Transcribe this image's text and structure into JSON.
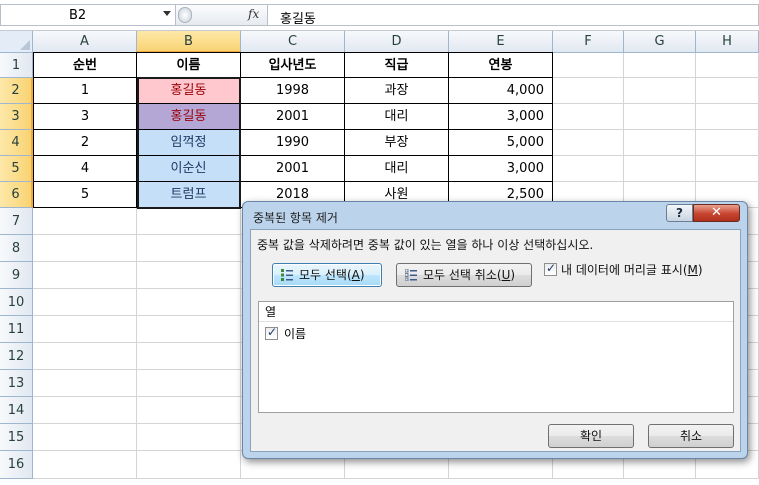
{
  "formula_bar": {
    "name_box": "B2",
    "fx_label": "fx",
    "content": "홍길동"
  },
  "columns": [
    "A",
    "B",
    "C",
    "D",
    "E",
    "F",
    "G",
    "H"
  ],
  "rows": [
    "1",
    "2",
    "3",
    "4",
    "5",
    "6",
    "7",
    "8",
    "9",
    "10",
    "11",
    "12",
    "13",
    "14",
    "15",
    "16"
  ],
  "table": {
    "headers": [
      "순번",
      "이름",
      "입사년도",
      "직급",
      "연봉"
    ],
    "data": [
      [
        "1",
        "홍길동",
        "1998",
        "과장",
        "4,000"
      ],
      [
        "3",
        "홍길동",
        "2001",
        "대리",
        "3,000"
      ],
      [
        "2",
        "임꺽정",
        "1990",
        "부장",
        "5,000"
      ],
      [
        "4",
        "이순신",
        "2001",
        "대리",
        "3,000"
      ],
      [
        "5",
        "트럼프",
        "2018",
        "사원",
        "2,500"
      ]
    ],
    "name_fill_colors": [
      "#ffc7ce",
      "#b4a7d6",
      "#c5dff8",
      "#c5dff8",
      "#c5dff8"
    ],
    "name_text_colors": [
      "#9c0006",
      "#9c0006",
      "#1f3864",
      "#1f3864",
      "#1f3864"
    ]
  },
  "dialog": {
    "title": "중복된 항목 제거",
    "help_label": "?",
    "close_label": "✕",
    "message": "중복 값을 삭제하려면 중복 값이 있는 열을 하나 이상 선택하십시오.",
    "select_all": {
      "label": "모두 선택(",
      "key": "A",
      "end": ")"
    },
    "unselect_all": {
      "label": "모두 선택 취소(",
      "key": "U",
      "end": ")"
    },
    "header_checkbox": {
      "label": "내 데이터에 머리글 표시(",
      "key": "M",
      "end": ")",
      "checked": true
    },
    "list_header": "열",
    "list_items": [
      {
        "label": "이름",
        "checked": true
      }
    ],
    "ok_label": "확인",
    "cancel_label": "취소"
  }
}
